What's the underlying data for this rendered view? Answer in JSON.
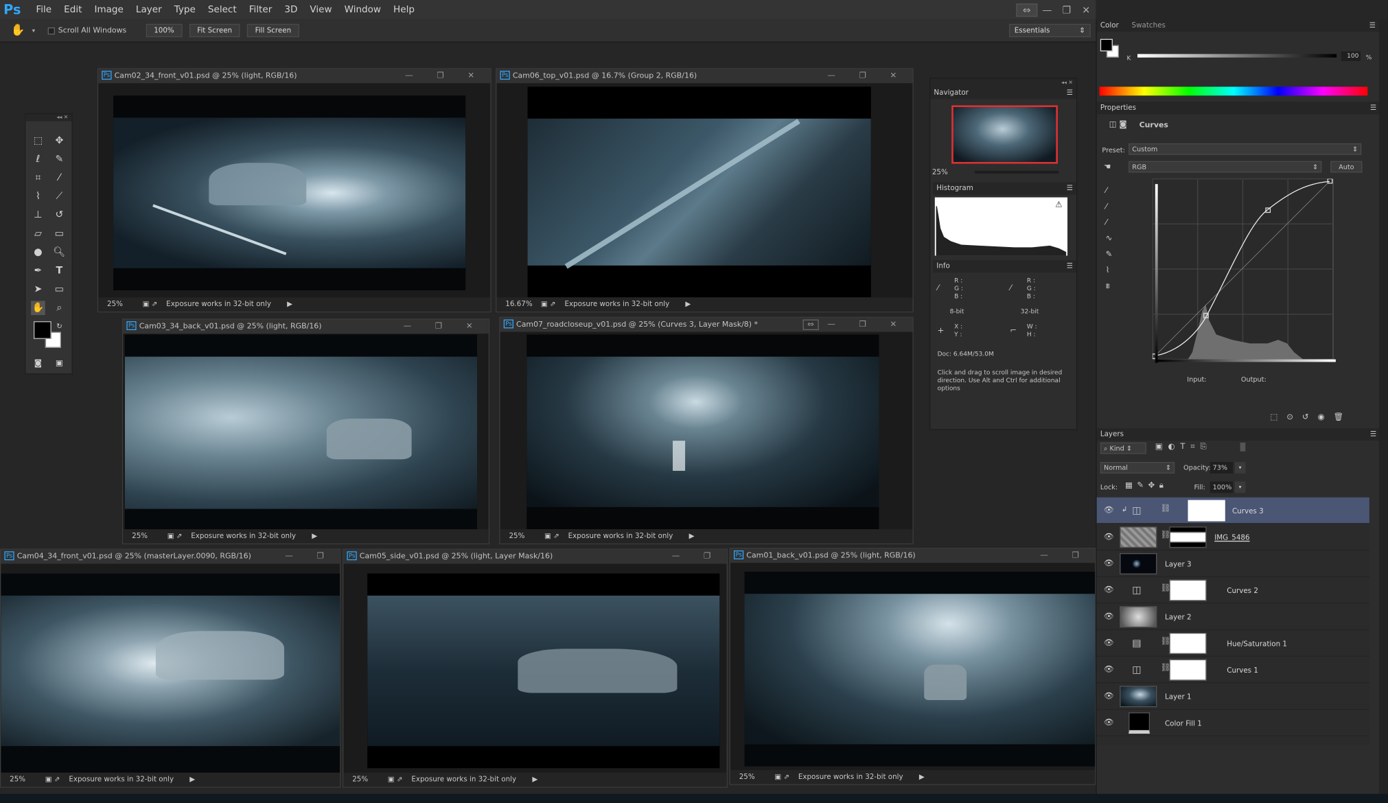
{
  "menu": {
    "logo": "Ps",
    "items": [
      "File",
      "Edit",
      "Image",
      "Layer",
      "Type",
      "Select",
      "Filter",
      "3D",
      "View",
      "Window",
      "Help"
    ]
  },
  "options": {
    "scroll_all": "Scroll All Windows",
    "zoom": "100%",
    "fit": "Fit Screen",
    "fill": "Fill Screen",
    "workspace": "Essentials"
  },
  "docs": [
    {
      "title": "Cam02_34_front_v01.psd @ 25% (light, RGB/16)",
      "zoom": "25%",
      "status": "Exposure works in 32-bit only"
    },
    {
      "title": "Cam06_top_v01.psd @ 16.7% (Group 2, RGB/16)",
      "zoom": "16.67%",
      "status": "Exposure works in 32-bit only"
    },
    {
      "title": "Cam03_34_back_v01.psd @ 25% (light, RGB/16)",
      "zoom": "25%",
      "status": "Exposure works in 32-bit only"
    },
    {
      "title": "Cam07_roadcloseup_v01.psd @ 25% (Curves 3, Layer Mask/8) *",
      "zoom": "25%",
      "status": "Exposure works in 32-bit only"
    },
    {
      "title": "Cam04_34_front_v01.psd @ 25% (masterLayer.0090, RGB/16)",
      "zoom": "25%",
      "status": "Exposure works in 32-bit only"
    },
    {
      "title": "Cam05_side_v01.psd @ 25% (light, Layer Mask/16)",
      "zoom": "25%",
      "status": "Exposure works in 32-bit only"
    },
    {
      "title": "Cam01_back_v01.psd @ 25% (light, RGB/16)",
      "zoom": "25%",
      "status": "Exposure works in 32-bit only"
    }
  ],
  "navigator": {
    "title": "Navigator",
    "zoom": "25%"
  },
  "histogram": {
    "title": "Histogram"
  },
  "info": {
    "title": "Info",
    "rgb": "R :\nG :\nB :",
    "bit8": "8-bit",
    "bit32": "32-bit",
    "xy": "X :\nY :",
    "wh": "W :\nH :",
    "doc": "Doc: 6.64M/53.0M",
    "hint": "Click and drag to scroll image in desired direction.  Use Alt and Ctrl for additional options"
  },
  "color": {
    "tab1": "Color",
    "tab2": "Swatches",
    "channel": "K",
    "value": "100",
    "unit": "%"
  },
  "properties": {
    "title": "Properties",
    "adjust": "Curves",
    "preset_label": "Preset:",
    "preset": "Custom",
    "channel": "RGB",
    "auto": "Auto",
    "input": "Input:",
    "output": "Output:"
  },
  "layers": {
    "title": "Layers",
    "kind": "Kind",
    "blend": "Normal",
    "opacity_label": "Opacity:",
    "opacity": "73%",
    "lock_label": "Lock:",
    "fill_label": "Fill:",
    "fill": "100%",
    "items": [
      {
        "name": "Curves 3",
        "type": "curves",
        "selected": true
      },
      {
        "name": "IMG_5486",
        "type": "image-mask"
      },
      {
        "name": "Layer 3",
        "type": "dark"
      },
      {
        "name": "Curves 2",
        "type": "curves"
      },
      {
        "name": "Layer 2",
        "type": "gray"
      },
      {
        "name": "Hue/Saturation 1",
        "type": "huesat"
      },
      {
        "name": "Curves 1",
        "type": "curves"
      },
      {
        "name": "Layer 1",
        "type": "photo"
      },
      {
        "name": "Color Fill 1",
        "type": "fill"
      }
    ]
  },
  "colors": {
    "accent": "#31a8ff",
    "selected_layer": "#4a5674",
    "nav_box": "#e03030"
  }
}
